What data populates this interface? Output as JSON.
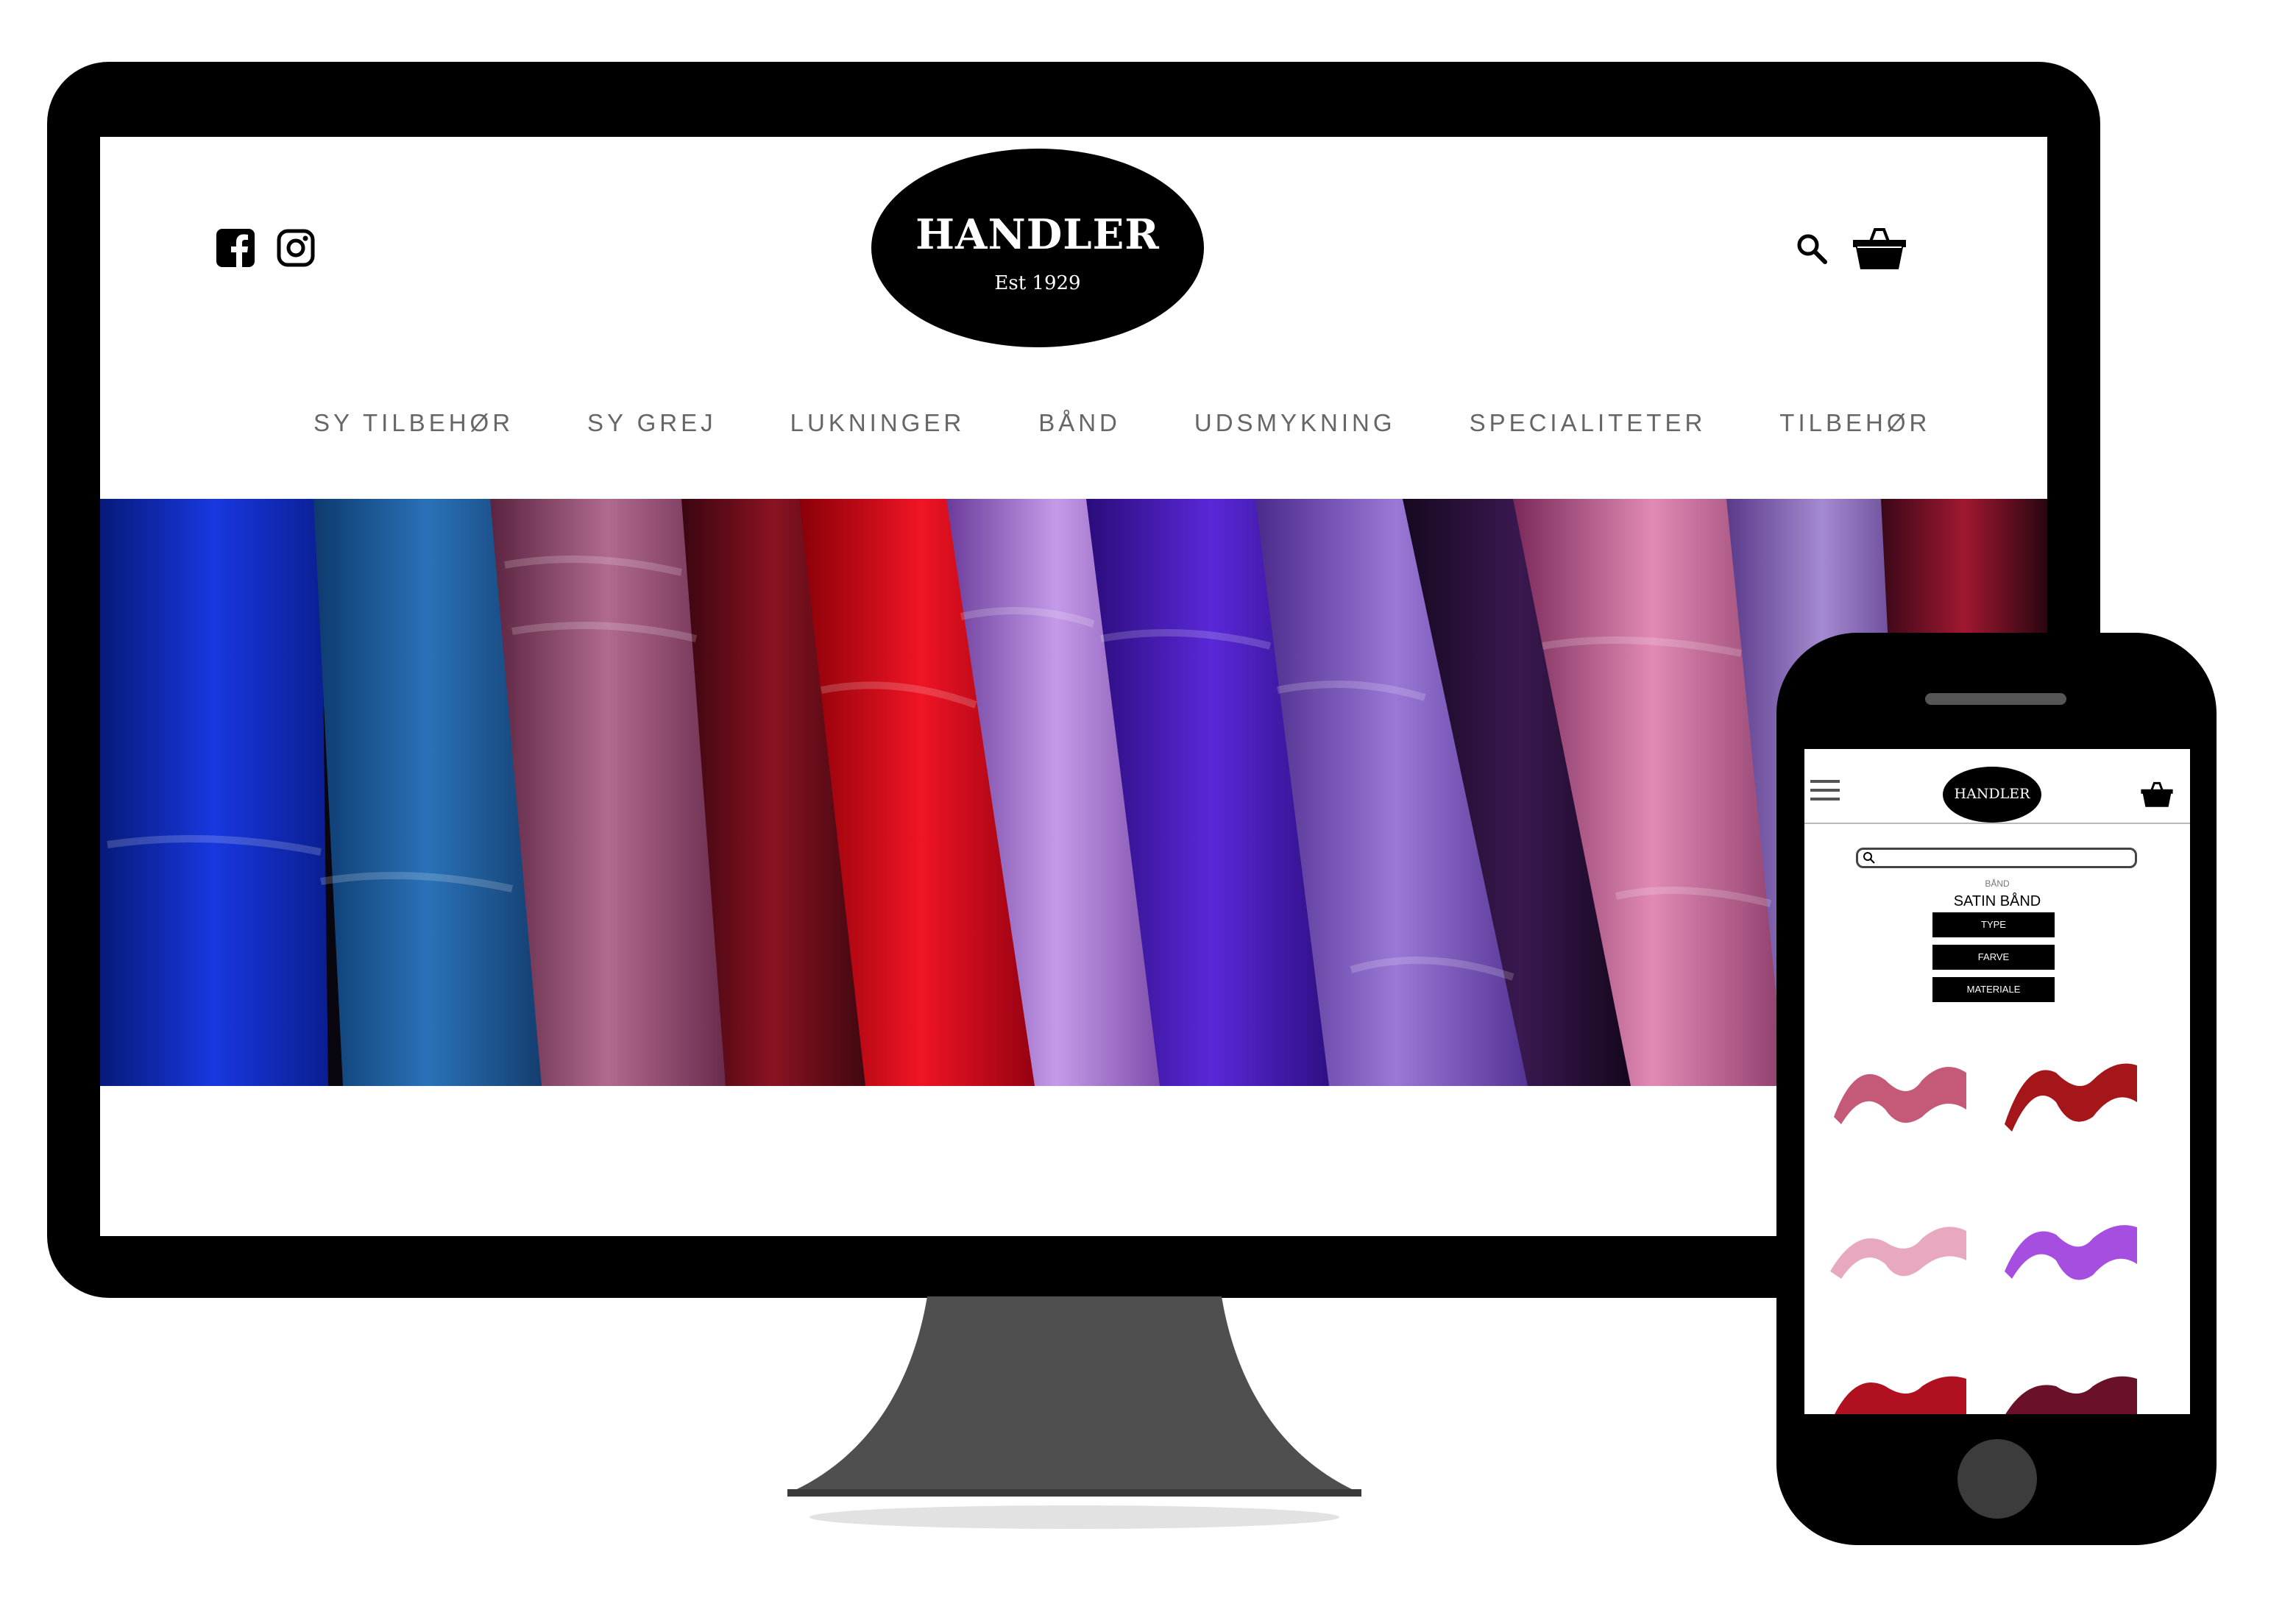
{
  "desktop": {
    "logo": {
      "name": "HANDLER",
      "est": "Est 1929"
    },
    "nav": [
      "SY TILBEHØR",
      "SY GREJ",
      "LUKNINGER",
      "BÅND",
      "UDSMYKNING",
      "SPECIALITETER",
      "TILBEHØR"
    ],
    "social_icons": [
      "facebook-icon",
      "instagram-icon"
    ],
    "tool_icons": [
      "search-icon",
      "basket-icon"
    ]
  },
  "phone": {
    "logo": "HANDLER",
    "breadcrumb": "BÅND",
    "title": "SATIN BÅND",
    "filters": [
      "TYPE",
      "FARVE",
      "MATERIALE"
    ],
    "product_colors": [
      "#c45a78",
      "#a4161a",
      "#e8a8c0",
      "#a64ee0",
      "#b01020",
      "#6a1028"
    ]
  }
}
